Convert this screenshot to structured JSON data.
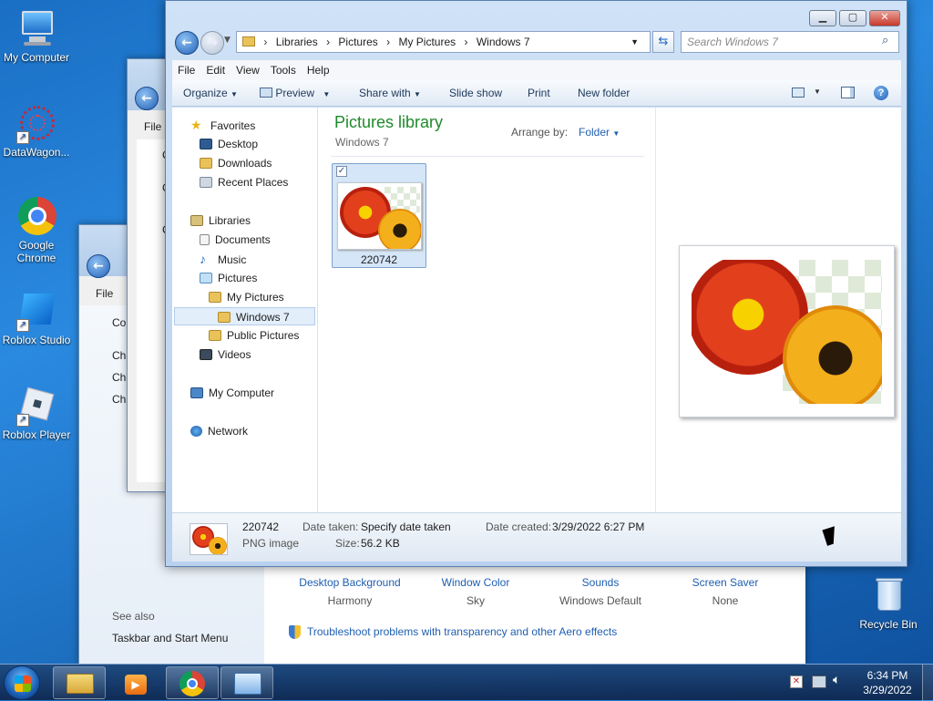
{
  "desktop": {
    "icons": [
      {
        "label": "My Computer"
      },
      {
        "label": "DataWagon..."
      },
      {
        "label": "Google Chrome"
      },
      {
        "label": "Roblox Studio"
      },
      {
        "label": "Roblox Player"
      },
      {
        "label": "Recycle Bin"
      }
    ]
  },
  "bg_windows": {
    "win1": {
      "menu": "File",
      "frag": [
        "C",
        "C",
        "C"
      ]
    },
    "win2": {
      "menu": "File",
      "frag": [
        "Co",
        "Cha",
        "Cha",
        "Cha",
        "S",
        "T"
      ]
    }
  },
  "control_panel": {
    "items": [
      {
        "label": "Desktop Background",
        "value": "Harmony"
      },
      {
        "label": "Window Color",
        "value": "Sky"
      },
      {
        "label": "Sounds",
        "value": "Windows Default"
      },
      {
        "label": "Screen Saver",
        "value": "None"
      }
    ],
    "see_also": "See also",
    "taskbar_link": "Taskbar and Start Menu",
    "troubleshoot": "Troubleshoot problems with transparency and other Aero effects"
  },
  "explorer": {
    "breadcrumb": [
      "Libraries",
      "Pictures",
      "My Pictures",
      "Windows 7"
    ],
    "search_placeholder": "Search Windows 7",
    "menu": [
      "File",
      "Edit",
      "View",
      "Tools",
      "Help"
    ],
    "toolbar": {
      "organize": "Organize",
      "preview": "Preview",
      "share": "Share with",
      "slideshow": "Slide show",
      "print": "Print",
      "new_folder": "New folder"
    },
    "nav": {
      "favorites": "Favorites",
      "desktop": "Desktop",
      "downloads": "Downloads",
      "recent": "Recent Places",
      "libraries": "Libraries",
      "documents": "Documents",
      "music": "Music",
      "pictures": "Pictures",
      "my_pictures": "My Pictures",
      "windows7": "Windows 7",
      "public_pictures": "Public Pictures",
      "videos": "Videos",
      "my_computer": "My Computer",
      "network": "Network"
    },
    "library_title": "Pictures library",
    "library_sub": "Windows 7",
    "arrange_label": "Arrange by:",
    "arrange_value": "Folder",
    "file": {
      "name": "220742"
    },
    "details": {
      "name": "220742",
      "type": "PNG image",
      "date_taken_label": "Date taken:",
      "date_taken_value": "Specify date taken",
      "size_label": "Size:",
      "size_value": "56.2 KB",
      "date_created_label": "Date created:",
      "date_created_value": "3/29/2022 6:27 PM"
    }
  },
  "taskbar": {
    "time": "6:34 PM",
    "date": "3/29/2022"
  },
  "colors": {
    "accent": "#1f5fb1",
    "library_title": "#1e8a2a"
  }
}
